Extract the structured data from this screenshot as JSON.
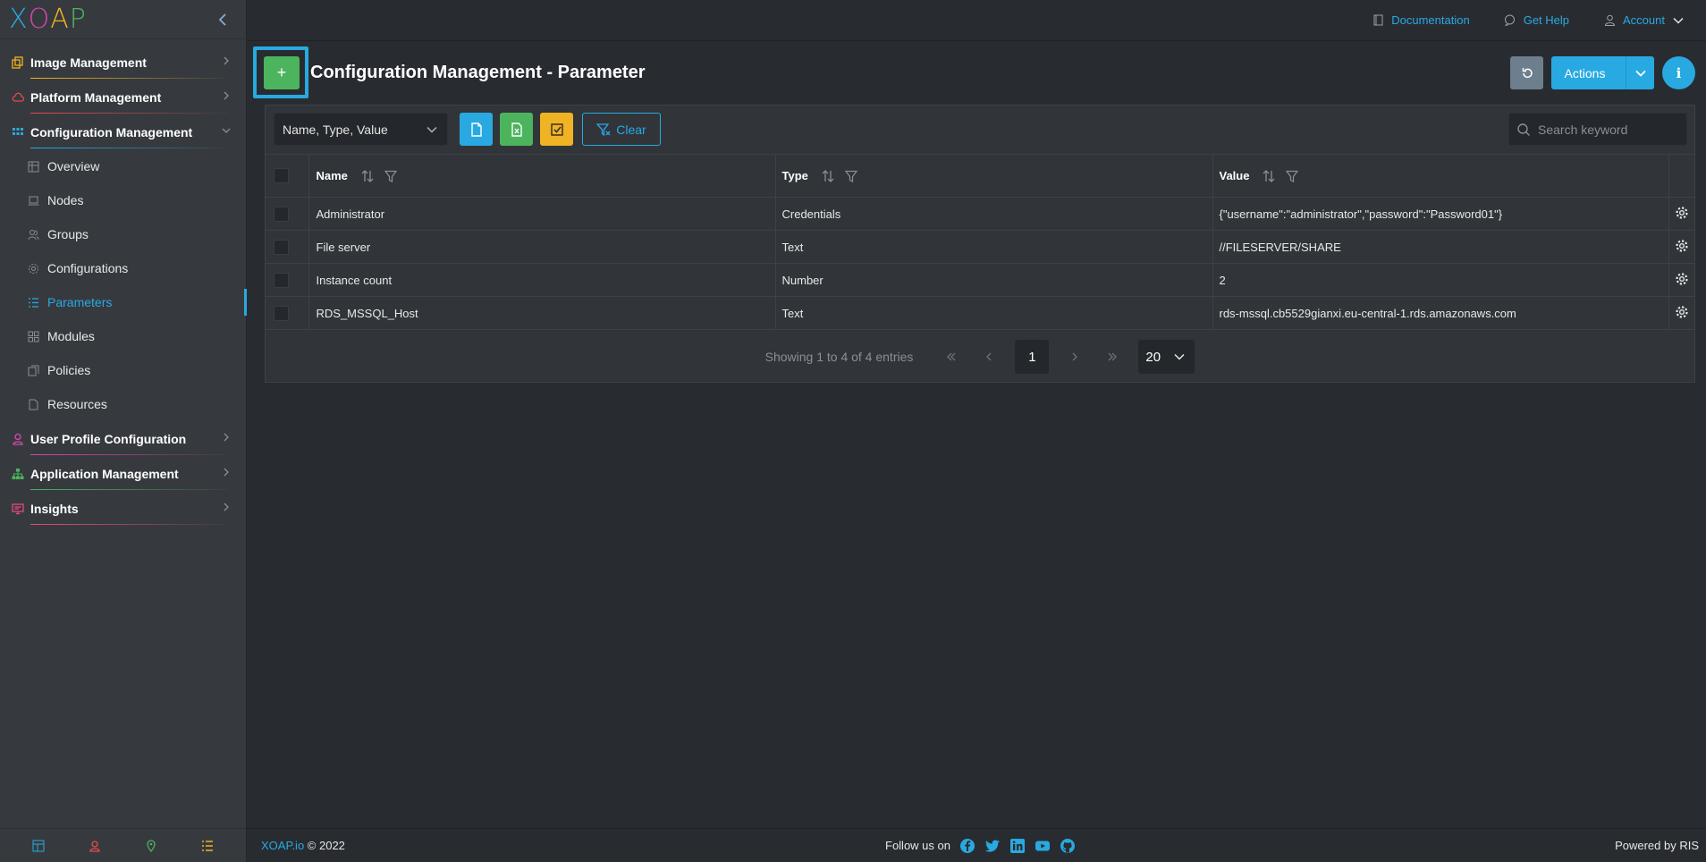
{
  "app": {
    "logo_letters": [
      "X",
      "O",
      "A",
      "P"
    ]
  },
  "sidebar": {
    "groups": [
      {
        "label": "Image Management",
        "icon": "copy-icon",
        "color": "#f0b323"
      },
      {
        "label": "Platform Management",
        "icon": "cloud-icon",
        "color": "#e34b4b"
      },
      {
        "label": "Configuration Management",
        "icon": "grid-icon",
        "color": "#29a9e1",
        "expanded": true
      },
      {
        "label": "User Profile Configuration",
        "icon": "user-icon",
        "color": "#d946a8"
      },
      {
        "label": "Application Management",
        "icon": "sitemap-icon",
        "color": "#4cb45d"
      },
      {
        "label": "Insights",
        "icon": "monitor-icon",
        "color": "#e34b7a"
      }
    ],
    "config_items": [
      {
        "label": "Overview",
        "icon": "table-icon"
      },
      {
        "label": "Nodes",
        "icon": "laptop-icon"
      },
      {
        "label": "Groups",
        "icon": "users-icon"
      },
      {
        "label": "Configurations",
        "icon": "gear-icon"
      },
      {
        "label": "Parameters",
        "icon": "list-icon",
        "active": true
      },
      {
        "label": "Modules",
        "icon": "modules-icon"
      },
      {
        "label": "Policies",
        "icon": "copy-icon"
      },
      {
        "label": "Resources",
        "icon": "file-icon"
      }
    ]
  },
  "topbar": {
    "documentation": "Documentation",
    "get_help": "Get Help",
    "account": "Account"
  },
  "header": {
    "add_label": "+",
    "title": "Configuration Management - Parameter",
    "actions_label": "Actions",
    "info_label": "i"
  },
  "toolbar": {
    "column_select": "Name, Type, Value",
    "clear_label": "Clear",
    "search_placeholder": "Search keyword"
  },
  "table": {
    "columns": [
      "Name",
      "Type",
      "Value"
    ],
    "rows": [
      {
        "name": "Administrator",
        "type": "Credentials",
        "value": "{\"username\":\"administrator\",\"password\":\"Password01\"}"
      },
      {
        "name": "File server",
        "type": "Text",
        "value": "//FILESERVER/SHARE"
      },
      {
        "name": "Instance count",
        "type": "Number",
        "value": "2"
      },
      {
        "name": "RDS_MSSQL_Host",
        "type": "Text",
        "value": "rds-mssql.cb5529gianxi.eu-central-1.rds.amazonaws.com"
      }
    ]
  },
  "pager": {
    "info": "Showing 1 to 4 of 4 entries",
    "current_page": "1",
    "per_page": "20"
  },
  "footer": {
    "brand": "XOAP.io",
    "copyright": " © 2022",
    "follow": "Follow us on",
    "powered": "Powered by RIS"
  },
  "colors": {
    "accent": "#29a9e1",
    "success": "#4cb45d",
    "warning": "#f0b323"
  }
}
